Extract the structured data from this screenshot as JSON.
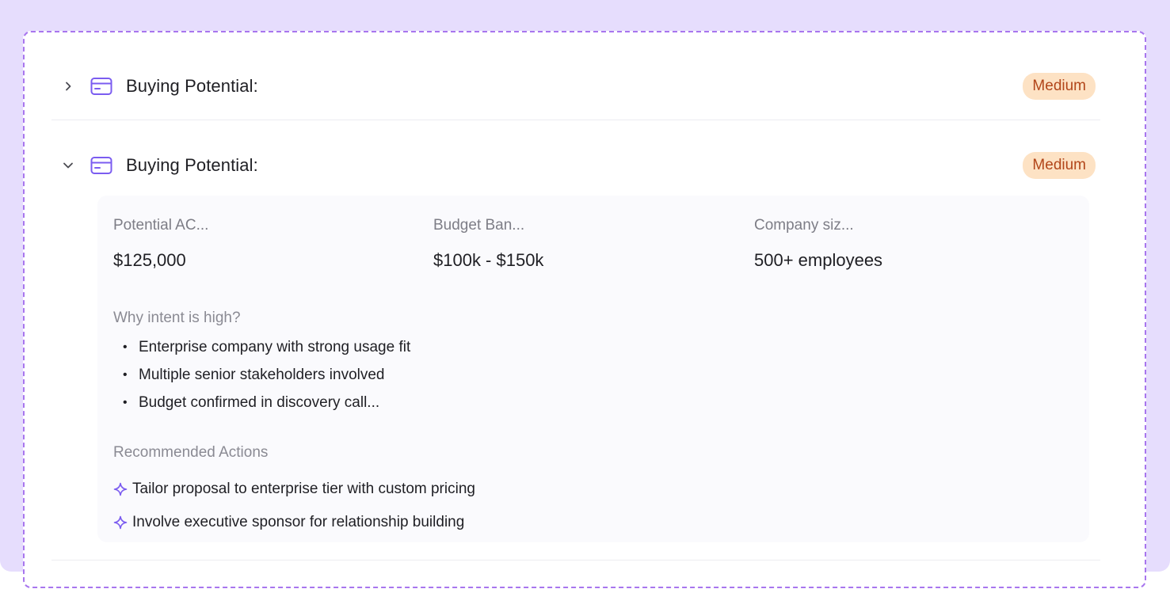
{
  "sections": [
    {
      "title": "Buying Potential:",
      "badge": "Medium",
      "expanded": false,
      "icon": "credit-card-icon"
    },
    {
      "title": "Buying Potential:",
      "badge": "Medium",
      "expanded": true,
      "icon": "credit-card-icon",
      "metrics": [
        {
          "label": "Potential AC...",
          "value": "$125,000"
        },
        {
          "label": "Budget Ban...",
          "value": "$100k - $150k"
        },
        {
          "label": "Company siz...",
          "value": "500+ employees"
        }
      ],
      "intent_heading": "Why intent is high?",
      "intent_reasons": [
        "Enterprise company with strong usage fit",
        "Multiple senior stakeholders involved",
        "Budget confirmed in discovery call..."
      ],
      "actions_heading": "Recommended Actions",
      "actions": [
        "Tailor proposal to enterprise tier with custom pricing",
        "Involve executive sponsor for relationship building"
      ]
    }
  ],
  "colors": {
    "accent": "#7b5cf0",
    "badge_bg": "#fde2c4",
    "badge_text": "#b2461a",
    "backdrop": "#e6ddfd",
    "frame_border": "#a876ee"
  },
  "bullet_glyph": "•"
}
